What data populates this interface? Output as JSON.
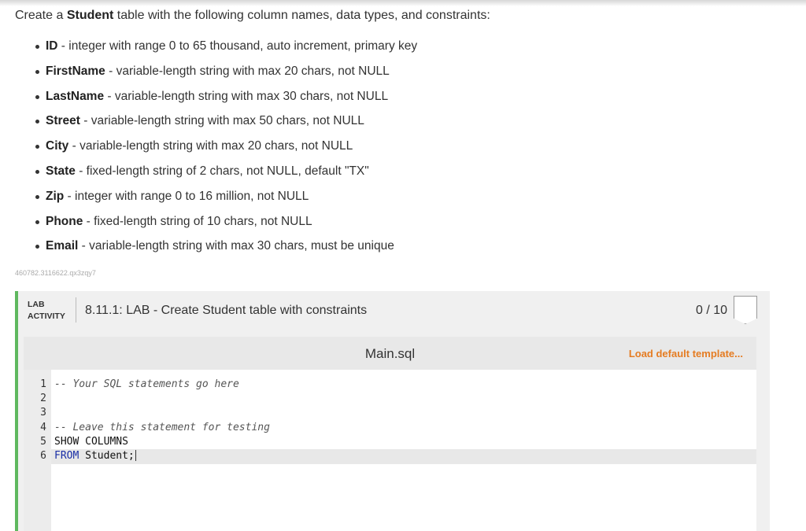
{
  "intro": {
    "prefix": "Create a ",
    "table": "Student",
    "suffix": " table with the following column names, data types, and constraints:"
  },
  "columns": [
    {
      "name": "ID",
      "desc": " - integer with range 0 to 65 thousand, auto increment, primary key"
    },
    {
      "name": "FirstName",
      "desc": " - variable-length string with max 20 chars, not NULL"
    },
    {
      "name": "LastName",
      "desc": " - variable-length string with max 30 chars, not NULL"
    },
    {
      "name": "Street",
      "desc": " - variable-length string with max 50 chars, not NULL"
    },
    {
      "name": "City",
      "desc": " - variable-length string with max 20 chars, not NULL"
    },
    {
      "name": "State",
      "desc": " - fixed-length string of 2 chars, not NULL, default \"TX\""
    },
    {
      "name": "Zip",
      "desc": " - integer with range 0 to 16 million, not NULL"
    },
    {
      "name": "Phone",
      "desc": " - fixed-length string of 10 chars, not NULL"
    },
    {
      "name": "Email",
      "desc": " - variable-length string with max 30 chars, must be unique"
    }
  ],
  "code_id": "460782.3116622.qx3zqy7",
  "lab": {
    "kind_line1": "LAB",
    "kind_line2": "ACTIVITY",
    "title": "8.11.1: LAB - Create Student table with constraints",
    "score": "0 / 10",
    "file_name": "Main.sql",
    "load_template": "Load default template...",
    "line_numbers": [
      "1",
      "2",
      "3",
      "4",
      "5",
      "6"
    ],
    "code": {
      "line1": "-- Your SQL statements go here",
      "line4": "-- Leave this statement for testing",
      "line5": "SHOW COLUMNS",
      "line6_keyword": "FROM",
      "line6_rest": " Student;"
    }
  }
}
